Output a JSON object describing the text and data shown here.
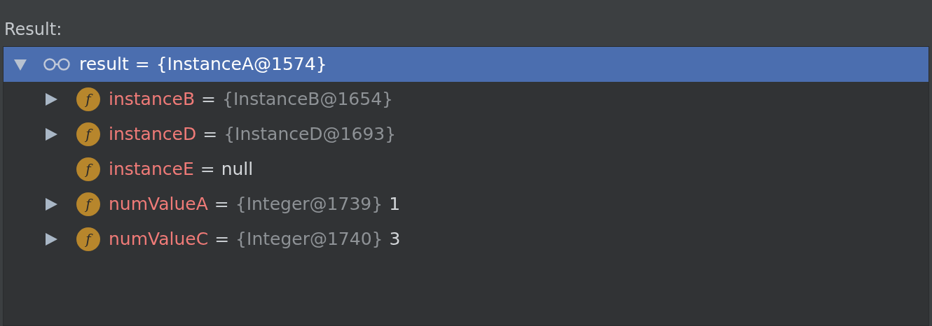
{
  "label": "Result:",
  "tree": {
    "name": "result",
    "operator": "=",
    "type": "{InstanceA@1574}",
    "kind": "watch",
    "expanded": true,
    "selected": true,
    "children": [
      {
        "name": "instanceB",
        "operator": "=",
        "type": "{InstanceB@1654}",
        "kind": "field",
        "icon_letter": "f",
        "expanded": false,
        "selected": false
      },
      {
        "name": "instanceD",
        "operator": "=",
        "type": "{InstanceD@1693}",
        "kind": "field",
        "icon_letter": "f",
        "expanded": false,
        "selected": false
      },
      {
        "name": "instanceE",
        "operator": "=",
        "value": "null",
        "kind": "field",
        "icon_letter": "f",
        "selected": false
      },
      {
        "name": "numValueA",
        "operator": "=",
        "type": "{Integer@1739}",
        "value": "1",
        "kind": "field",
        "icon_letter": "f",
        "expanded": false,
        "selected": false
      },
      {
        "name": "numValueC",
        "operator": "=",
        "type": "{Integer@1740}",
        "value": "3",
        "kind": "field",
        "icon_letter": "f",
        "expanded": false,
        "selected": false
      }
    ]
  }
}
